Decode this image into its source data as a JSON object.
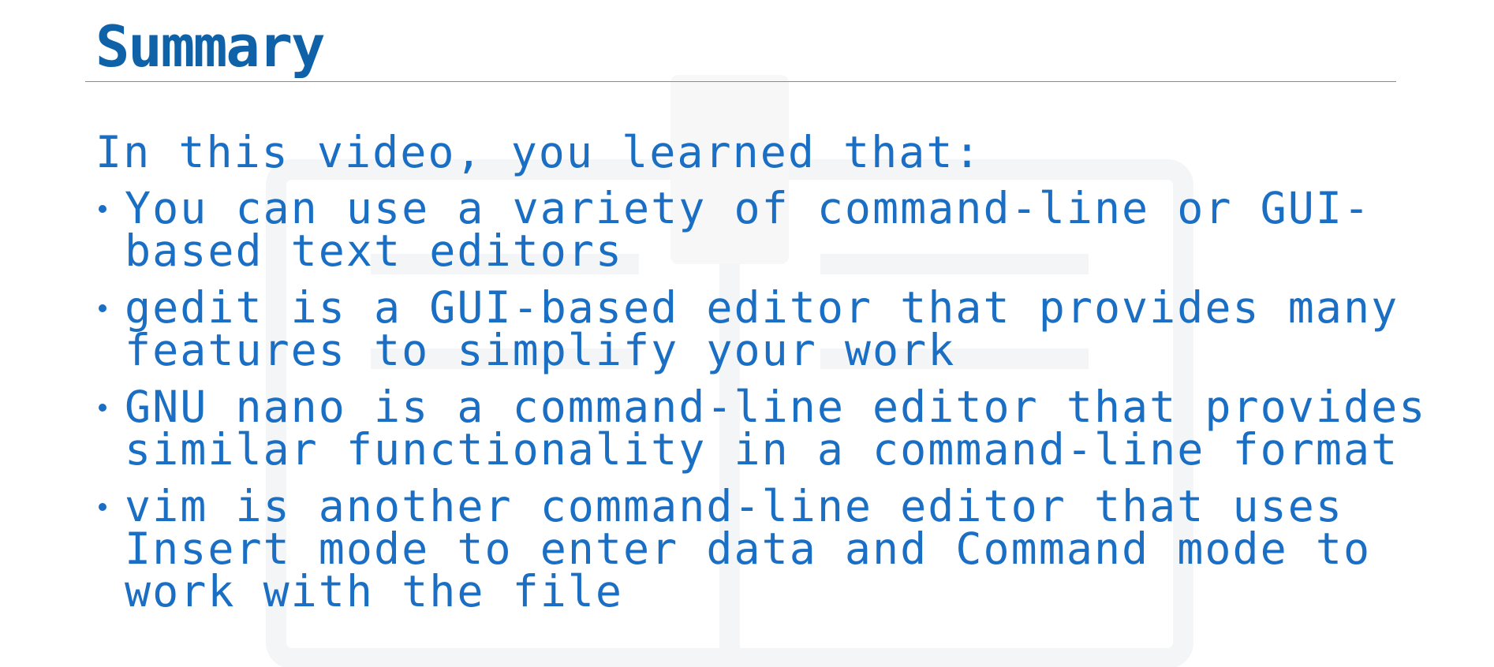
{
  "slide": {
    "title": "Summary",
    "intro": "In this video, you learned that:",
    "bullets": [
      {
        "text": "You can use a variety of command-line or GUI-based text editors"
      },
      {
        "text": "gedit is a GUI-based editor that provides many features to simplify your work"
      },
      {
        "text": "GNU nano is a command-line editor that provides similar functionality in a command-line format"
      },
      {
        "text": "vim is another command-line editor that uses Insert mode to enter data and Command mode to work with the file"
      }
    ]
  },
  "colors": {
    "title": "#0f62a8",
    "body": "#1a6fc4",
    "rule": "#6f8fb8",
    "background": "#ffffff"
  }
}
